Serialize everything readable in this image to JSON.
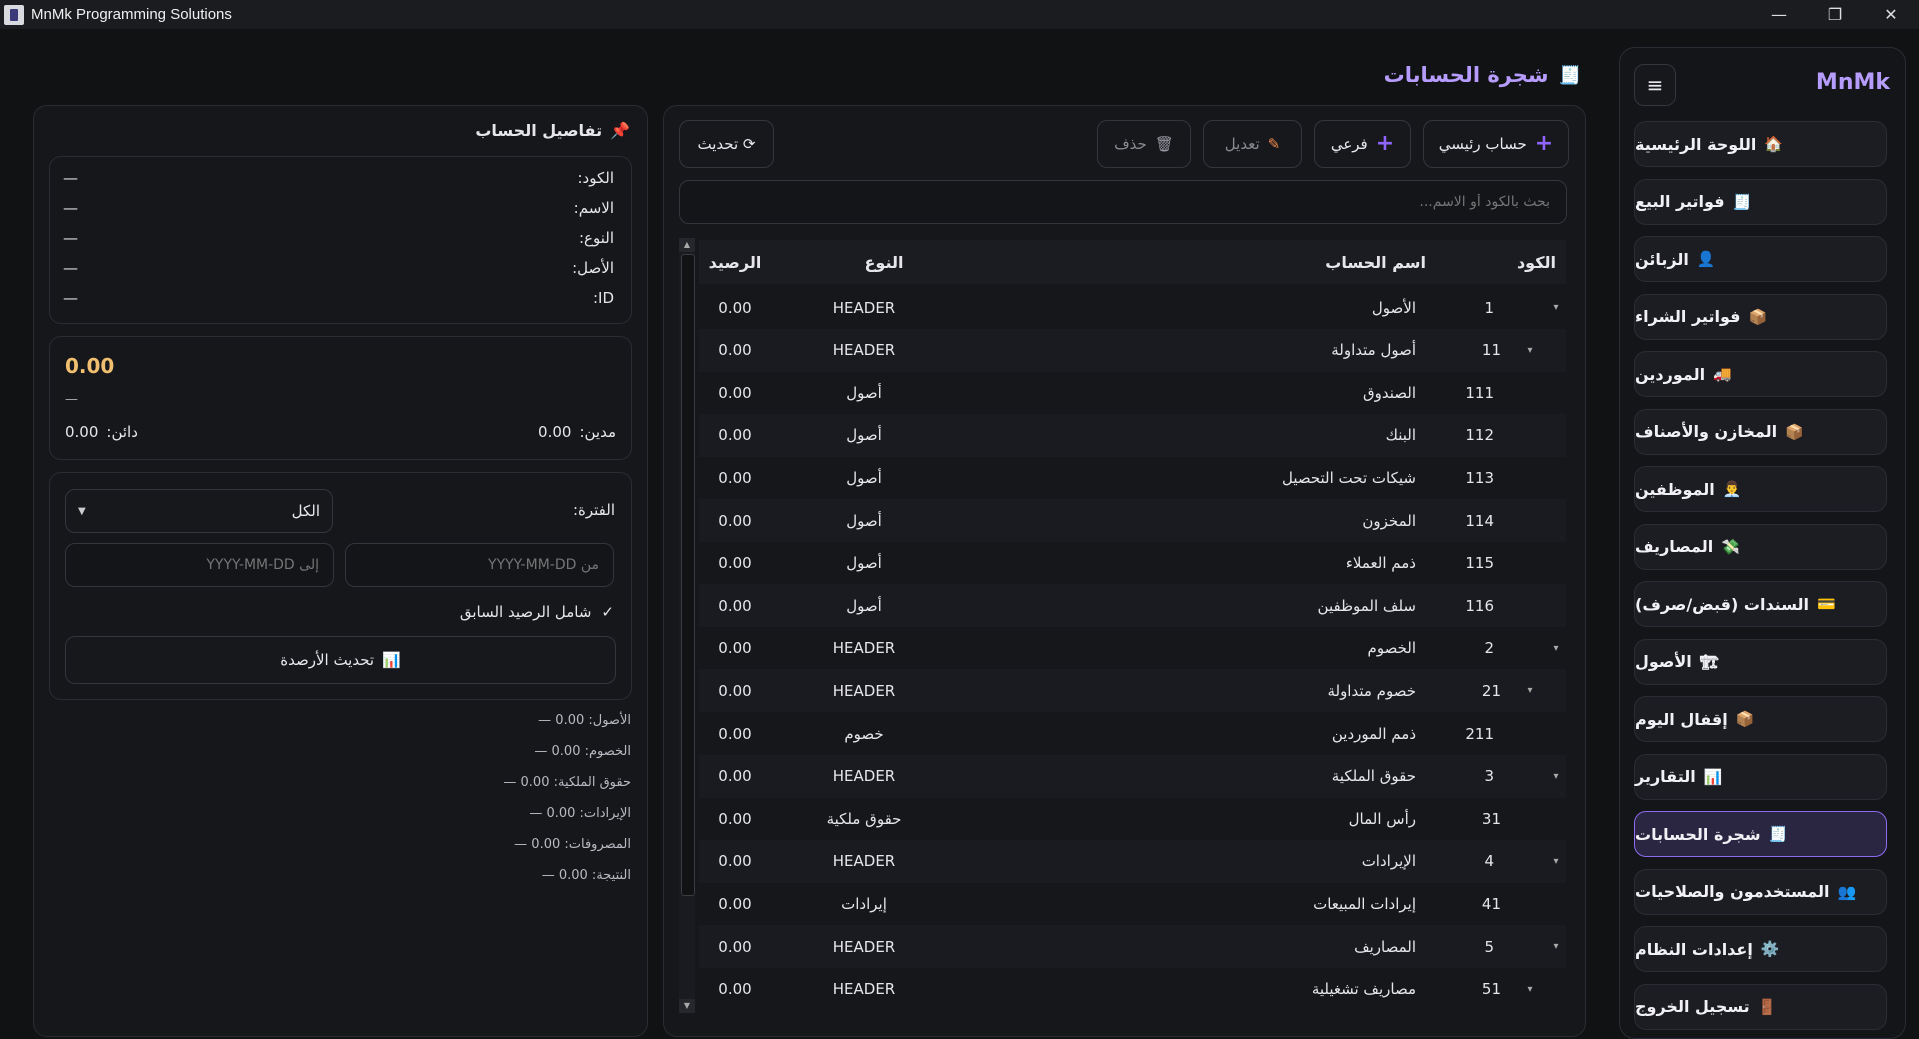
{
  "window": {
    "title": "MnMk Programming Solutions",
    "min": "—",
    "max": "❐",
    "close": "✕"
  },
  "sidebar": {
    "logo": "MnMk",
    "menu_icon": "≡",
    "items": [
      {
        "label": "اللوحة الرئيسية",
        "icon": "🏠"
      },
      {
        "label": "فواتير البيع",
        "icon": "🧾"
      },
      {
        "label": "الزبائن",
        "icon": "👤"
      },
      {
        "label": "فواتير الشراء",
        "icon": "📦"
      },
      {
        "label": "الموردين",
        "icon": "🚚"
      },
      {
        "label": "المخازن والأصناف",
        "icon": "📦"
      },
      {
        "label": "الموظفين",
        "icon": "👨‍💼"
      },
      {
        "label": "المصاريف",
        "icon": "💸"
      },
      {
        "label": "السندات (قبض/صرف)",
        "icon": "💳"
      },
      {
        "label": "الأصول",
        "icon": "🏗"
      },
      {
        "label": "إقفال اليوم",
        "icon": "📦"
      },
      {
        "label": "التقارير",
        "icon": "📊"
      },
      {
        "label": "شجرة الحسابات",
        "icon": "🧾"
      },
      {
        "label": "المستخدمون والصلاحيات",
        "icon": "👥"
      },
      {
        "label": "إعدادات النظام",
        "icon": "⚙️"
      },
      {
        "label": "تسجيل الخروج",
        "icon": "🚪"
      }
    ],
    "active_index": 12
  },
  "page": {
    "title": "شجرة الحسابات",
    "title_icon": "🧾"
  },
  "toolbar": {
    "main_account": "حساب رئيسي",
    "sub_account": "فرعي",
    "edit": "تعديل",
    "delete": "حذف",
    "refresh": "تحديث ⟳"
  },
  "search": {
    "placeholder": "بحث بالكود أو الاسم..."
  },
  "table": {
    "columns": {
      "code": "الكود",
      "name": "اسم الحساب",
      "type": "النوع",
      "balance": "الرصيد"
    },
    "rows": [
      {
        "code": "1",
        "name": "الأصول",
        "type": "HEADER",
        "balance": "0.00",
        "caret": "▾",
        "level": 0
      },
      {
        "code": "11",
        "name": "أصول متداولة",
        "type": "HEADER",
        "balance": "0.00",
        "caret": "▾",
        "level": 1
      },
      {
        "code": "111",
        "name": "الصندوق",
        "type": "أصول",
        "balance": "0.00",
        "caret": "",
        "level": 2
      },
      {
        "code": "112",
        "name": "البنك",
        "type": "أصول",
        "balance": "0.00",
        "caret": "",
        "level": 2
      },
      {
        "code": "113",
        "name": "شيكات تحت التحصيل",
        "type": "أصول",
        "balance": "0.00",
        "caret": "",
        "level": 2
      },
      {
        "code": "114",
        "name": "المخزون",
        "type": "أصول",
        "balance": "0.00",
        "caret": "",
        "level": 2
      },
      {
        "code": "115",
        "name": "ذمم العملاء",
        "type": "أصول",
        "balance": "0.00",
        "caret": "",
        "level": 2
      },
      {
        "code": "116",
        "name": "سلف الموظفين",
        "type": "أصول",
        "balance": "0.00",
        "caret": "",
        "level": 2
      },
      {
        "code": "2",
        "name": "الخصوم",
        "type": "HEADER",
        "balance": "0.00",
        "caret": "▾",
        "level": 0
      },
      {
        "code": "21",
        "name": "خصوم متداولة",
        "type": "HEADER",
        "balance": "0.00",
        "caret": "▾",
        "level": 1
      },
      {
        "code": "211",
        "name": "ذمم الموردين",
        "type": "خصوم",
        "balance": "0.00",
        "caret": "",
        "level": 2
      },
      {
        "code": "3",
        "name": "حقوق الملكية",
        "type": "HEADER",
        "balance": "0.00",
        "caret": "▾",
        "level": 0
      },
      {
        "code": "31",
        "name": "رأس المال",
        "type": "حقوق ملكية",
        "balance": "0.00",
        "caret": "",
        "level": 1
      },
      {
        "code": "4",
        "name": "الإيرادات",
        "type": "HEADER",
        "balance": "0.00",
        "caret": "▾",
        "level": 0
      },
      {
        "code": "41",
        "name": "إيرادات المبيعات",
        "type": "إيرادات",
        "balance": "0.00",
        "caret": "",
        "level": 1
      },
      {
        "code": "5",
        "name": "المصاريف",
        "type": "HEADER",
        "balance": "0.00",
        "caret": "▾",
        "level": 0
      },
      {
        "code": "51",
        "name": "مصاريف تشغيلية",
        "type": "HEADER",
        "balance": "0.00",
        "caret": "▾",
        "level": 1
      }
    ]
  },
  "details": {
    "title": "تفاصيل الحساب",
    "title_icon": "📌",
    "fields": [
      {
        "label": "الكود:",
        "value": "—"
      },
      {
        "label": "الاسم:",
        "value": "—"
      },
      {
        "label": "النوع:",
        "value": "—"
      },
      {
        "label": "الأصل:",
        "value": "—"
      },
      {
        "label": "ID:",
        "value": "—"
      }
    ],
    "balance": "0.00",
    "balance_sub": "—",
    "debit_label": "مدين:",
    "debit_value": "0.00",
    "credit_label": "دائن:",
    "credit_value": "0.00"
  },
  "filters": {
    "period_label": "الفترة:",
    "period_value": "الكل",
    "from_placeholder": "من YYYY-MM-DD",
    "to_placeholder": "إلى YYYY-MM-DD",
    "include_prev": "شامل الرصيد السابق",
    "include_prev_checked": true,
    "check_mark": "✓",
    "refresh_balances": "تحديث الأرصدة",
    "refresh_icon": "📊"
  },
  "summary": [
    "الأصول: 0.00 —",
    "الخصوم: 0.00 —",
    "حقوق الملكية: 0.00 —",
    "الإيرادات: 0.00 —",
    "المصروفات: 0.00 —",
    "النتيجة: 0.00 —"
  ],
  "colors": {
    "accent": "#8e63ff",
    "balance": "#f0c070",
    "title": "#b79cff"
  }
}
